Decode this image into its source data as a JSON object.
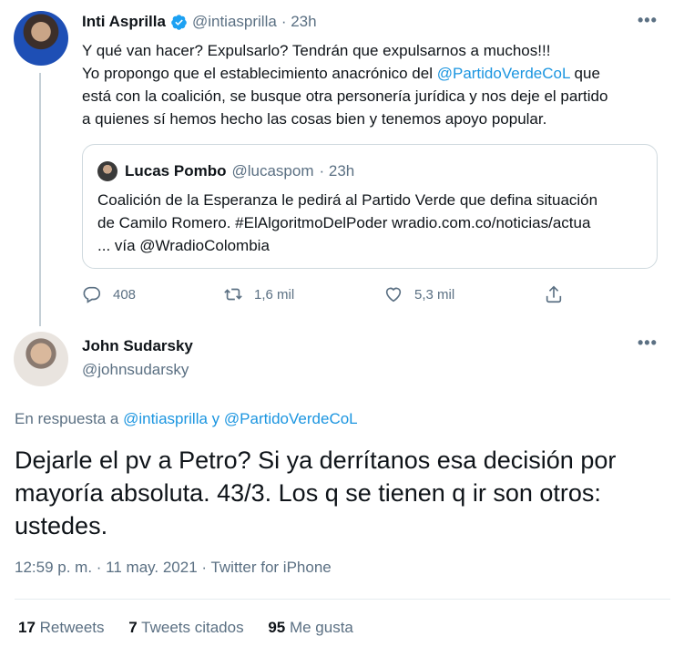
{
  "parent_tweet": {
    "name": "Inti Asprilla",
    "handle": "@intiasprilla",
    "time": "· 23h",
    "text_lines": [
      "Y qué van hacer? Expulsarlo? Tendrán que expulsarnos a muchos!!!",
      "Yo propongo que el establecimiento anacrónico del ",
      "@PartidoVerdeCoL",
      " que",
      "está con la coalición, se busque otra personería jurídica y nos deje el partido",
      "a quienes sí hemos hecho las cosas bien y tenemos apoyo popular."
    ],
    "quote": {
      "name": "Lucas Pombo",
      "handle": "@lucaspom",
      "time": "· 23h",
      "lines": [
        "Coalición de la Esperanza le pedirá al Partido Verde que defina situación",
        "de Camilo Romero. #ElAlgoritmoDelPoder wradio.com.co/noticias/actua",
        "... vía @WradioColombia"
      ]
    },
    "actions": {
      "replies": "408",
      "retweets": "1,6 mil",
      "likes": "5,3 mil"
    },
    "more_icon": "•••"
  },
  "main_tweet": {
    "name": "John Sudarsky",
    "handle": "@johnsudarsky",
    "more_icon": "•••",
    "reply_prefix": "En respuesta a ",
    "reply_user1": "@intiasprilla",
    "reply_conj": " y ",
    "reply_user2": "@PartidoVerdeCoL",
    "text_lines": [
      "Dejarle el pv a Petro? Si ya derrítanos esa decisión por",
      "mayoría absoluta. 43/3. Los q se tienen q ir son otros:",
      "ustedes."
    ],
    "meta": "12:59 p. m. · 11 may. 2021 · Twitter for iPhone",
    "stats": {
      "retweets_count": "17",
      "retweets_label": " Retweets",
      "quotes_count": "7",
      "quotes_label": " Tweets citados",
      "likes_count": "95",
      "likes_label": " Me gusta"
    }
  },
  "colors": {
    "link": "#1b95e0",
    "muted": "#5b7083",
    "verified": "#1da1f2"
  },
  "icons": [
    "verified-badge-icon",
    "reply-icon",
    "retweet-icon",
    "like-icon",
    "share-icon",
    "more-icon"
  ]
}
